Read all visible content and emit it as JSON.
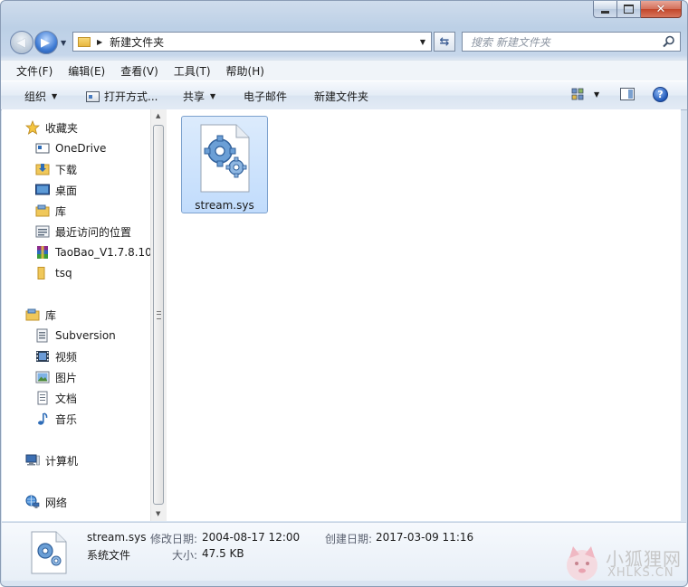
{
  "window": {
    "caption": {
      "minimize": "",
      "maximize": "",
      "close": "✕"
    }
  },
  "address": {
    "path": "新建文件夹",
    "search_placeholder": "搜索 新建文件夹"
  },
  "menu": [
    "文件(F)",
    "编辑(E)",
    "查看(V)",
    "工具(T)",
    "帮助(H)"
  ],
  "toolbar": {
    "organize": "组织",
    "open_with": "打开方式...",
    "share": "共享",
    "email": "电子邮件",
    "new_folder": "新建文件夹"
  },
  "nav": {
    "favorites": {
      "label": "收藏夹",
      "items": [
        "OneDrive",
        "下载",
        "桌面",
        "库",
        "最近访问的位置",
        "TaoBao_V1.7.8.10_",
        "tsq"
      ]
    },
    "libraries": {
      "label": "库",
      "items": [
        "Subversion",
        "视频",
        "图片",
        "文档",
        "音乐"
      ]
    },
    "computer": "计算机",
    "network": "网络"
  },
  "files": [
    {
      "name": "stream.sys",
      "selected": true
    }
  ],
  "details": {
    "name": "stream.sys",
    "type": "系统文件",
    "modified_label": "修改日期:",
    "modified_value": "2004-08-17 12:00",
    "created_label": "创建日期:",
    "created_value": "2017-03-09 11:16",
    "size_label": "大小:",
    "size_value": "47.5 KB"
  },
  "watermark": {
    "cn": "小狐狸网",
    "en": "XHLKS.CN"
  },
  "colors": {
    "selection_fill": "#c1dcfc",
    "selection_border": "#7da2ce",
    "close_red": "#c2462a"
  }
}
